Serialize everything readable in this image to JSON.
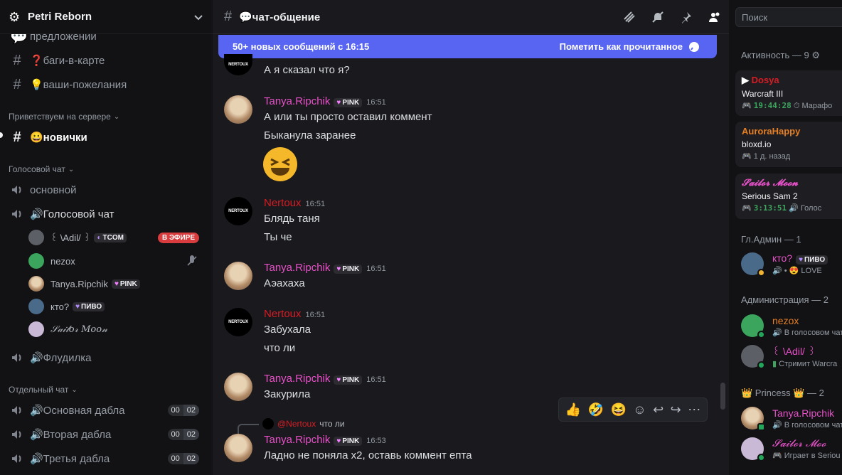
{
  "server": {
    "name": "Petri Reborn"
  },
  "channels": {
    "partial_top": "предложений",
    "bugs": "❓баги-в-карте",
    "wishes": "💡ваши-пожелания",
    "cat_welcome": "Приветствуем на сервере",
    "newbies": "😀новички",
    "cat_voice": "Голосовой чат",
    "main_voice": "основной",
    "voice_chat": "🔊Голосовой чат",
    "floodilka": "🔊Флудилка",
    "cat_separate": "Отдельный чат",
    "dabla1": "🔊Основная дабла",
    "dabla2": "🔊Вторая дабла",
    "dabla3": "🔊Третья дабла",
    "counter_left": "00",
    "counter_right": "02"
  },
  "voice_users": [
    {
      "name": "꒰ \\Adil/ ꒱",
      "tag": "TCOM",
      "live": "В ЭФИРЕ"
    },
    {
      "name": "nezox"
    },
    {
      "name": "Tanya.Ripchik",
      "tag": "PINK"
    },
    {
      "name": "кто?",
      "tag": "ПИВО"
    },
    {
      "name": "𝒮𝒶𝒾𝓁𝑜𝓇 𝑀𝑜𝑜𝓃"
    }
  ],
  "chat": {
    "channel_title": "💬чат-общение",
    "banner_text": "50+ новых сообщений с 16:15",
    "banner_action": "Пометить как прочитанное"
  },
  "messages": {
    "m0_line": "А я сказал что я?",
    "m1_name": "Tanya.Ripchik",
    "m1_tag": "PINK",
    "m1_time": "16:51",
    "m1_l1": "А или ты просто оставил коммент",
    "m1_l2": "Быканула заранее",
    "m2_name": "Nertoux",
    "m2_time": "16:51",
    "m2_l1": "Блядь таня",
    "m2_l2": "Ты че",
    "m3_name": "Tanya.Ripchik",
    "m3_tag": "PINK",
    "m3_time": "16:51",
    "m3_l1": "Аэахаха",
    "m4_name": "Nertoux",
    "m4_time": "16:51",
    "m4_l1": "Забухала",
    "m4_l2": "что ли",
    "m5_name": "Tanya.Ripchik",
    "m5_tag": "PINK",
    "m5_time": "16:51",
    "m5_l1": "Закурила",
    "reply_to": "@Nertoux",
    "reply_text": "что ли",
    "m6_name": "Tanya.Ripchik",
    "m6_tag": "PINK",
    "m6_time": "16:53",
    "m6_l1": "Ладно не поняла x2, оставь коммент епта",
    "avatar_text": "NERTOUX"
  },
  "reactions": [
    "👍",
    "🤣",
    "😆"
  ],
  "members": {
    "search_placeholder": "Поиск",
    "activity": "Активность — 9",
    "dosya": "Dosya",
    "dosya_game": "Warcraft III",
    "dosya_timer": "19:44:28",
    "dosya_sub": "Марафо",
    "aurora": "AuroraHappy",
    "aurora_game": "bloxd.io",
    "aurora_sub": "1 д. назад",
    "sailor": "𝓢𝓪𝓲𝓵𝓸𝓻 𝓜𝓸𝓸𝓷",
    "sailor_game": "Serious Sam 2",
    "sailor_timer": "3:13:51",
    "sailor_sub": "Голос",
    "cat_admin_main": "Гл.Админ — 1",
    "kto": "кто?",
    "kto_tag": "ПИВО",
    "kto_sub": "• 😍 LOVE",
    "cat_admin": "Администрация — 2",
    "nezox": "nezox",
    "nezox_sub": "В голосовом чат",
    "adil": "꒰ \\Adil/ ꒱",
    "adil_sub": "Стримит Warcra",
    "cat_princess": "👑 Princess 👑 — 2",
    "tanya": "Tanya.Ripchik",
    "tanya_sub": "В голосовом чат",
    "sailor2": "𝓢𝓪𝓲𝓵𝓸𝓻 𝓜𝓸𝓸",
    "sailor2_sub": "Играет в Seriou"
  },
  "colors": {
    "accent": "#5865f2",
    "pink_name": "#e651c8",
    "red_name": "#d71c24",
    "online": "#23a55a",
    "live": "#d83c3e"
  }
}
